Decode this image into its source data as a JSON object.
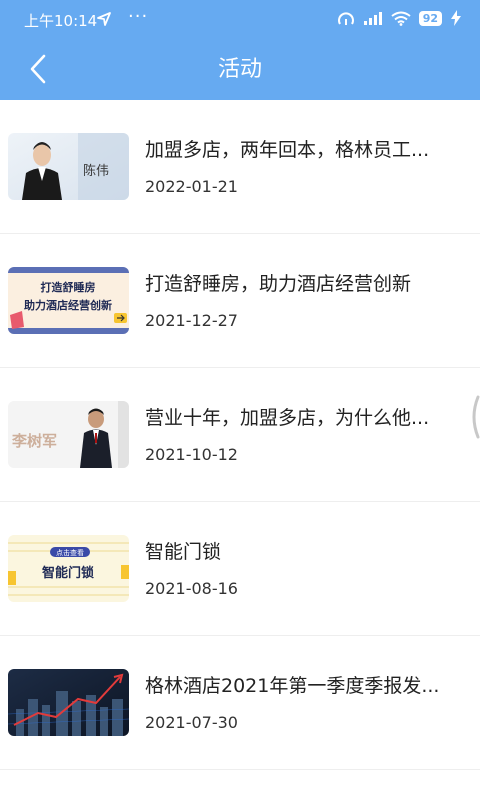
{
  "status_bar": {
    "time": "上午10:14",
    "dots": "···",
    "battery": "92"
  },
  "header": {
    "title": "活动"
  },
  "items": [
    {
      "title": "加盟多店，两年回本，格林员工...",
      "date": "2022-01-21",
      "thumb_text": "陈伟"
    },
    {
      "title": "打造舒睡房，助力酒店经营创新",
      "date": "2021-12-27",
      "thumb_line1": "打造舒睡房",
      "thumb_line2": "助力酒店经营创新"
    },
    {
      "title": "营业十年，加盟多店，为什么他...",
      "date": "2021-10-12",
      "thumb_text": "李树军"
    },
    {
      "title": "智能门锁",
      "date": "2021-08-16",
      "thumb_badge": "点击查看",
      "thumb_text": "智能门锁"
    },
    {
      "title": "格林酒店2021年第一季度季报发...",
      "date": "2021-07-30"
    }
  ]
}
